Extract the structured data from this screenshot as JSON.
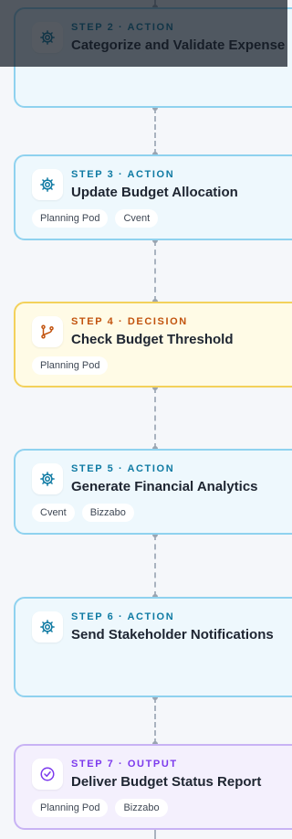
{
  "steps": [
    {
      "kicker": "STEP 2 · ACTION",
      "title": "Categorize and Validate Expense",
      "type": "action",
      "tags": []
    },
    {
      "kicker": "STEP 3 · ACTION",
      "title": "Update Budget Allocation",
      "type": "action",
      "tags": [
        "Planning Pod",
        "Cvent"
      ]
    },
    {
      "kicker": "STEP 4 · DECISION",
      "title": "Check Budget Threshold",
      "type": "decision",
      "tags": [
        "Planning Pod"
      ]
    },
    {
      "kicker": "STEP 5 · ACTION",
      "title": "Generate Financial Analytics",
      "type": "action",
      "tags": [
        "Cvent",
        "Bizzabo"
      ]
    },
    {
      "kicker": "STEP 6 · ACTION",
      "title": "Send Stakeholder Notifications",
      "type": "action",
      "tags": []
    },
    {
      "kicker": "STEP 7 · OUTPUT",
      "title": "Deliver Budget Status Report",
      "type": "output",
      "tags": [
        "Planning Pod",
        "Bizzabo"
      ]
    }
  ],
  "icons": {
    "action": "gear-icon",
    "decision": "branch-icon",
    "output": "check-circle-icon"
  },
  "colors": {
    "action": "#0e7aa3",
    "decision": "#c2530e",
    "output": "#7c3aed"
  }
}
